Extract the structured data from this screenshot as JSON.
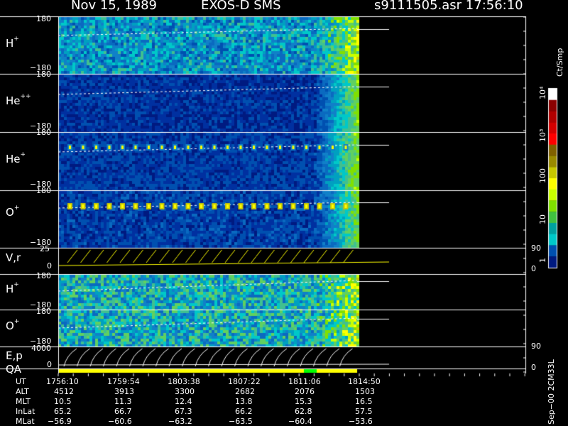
{
  "header": {
    "date": "Nov 15, 1989",
    "instrument": "EXOS-D SMS",
    "file_time": "s9111505.asr  17:56:10"
  },
  "panels": [
    {
      "label": "H",
      "charge": "+",
      "top": "180",
      "bottom": "−180"
    },
    {
      "label": "He",
      "charge": "++",
      "top": "180",
      "bottom": "−180"
    },
    {
      "label": "He",
      "charge": "+",
      "top": "180",
      "bottom": "−180"
    },
    {
      "label": "O",
      "charge": "+",
      "top": "180",
      "bottom": "−180"
    },
    {
      "label": "V,r",
      "charge": "",
      "top": "25",
      "bottom": "0",
      "right_top": "90",
      "right_bottom": "0"
    },
    {
      "label": "H",
      "charge": "+",
      "top": "180",
      "bottom": "−180"
    },
    {
      "label": "O",
      "charge": "+",
      "top": "180",
      "bottom": "−180"
    },
    {
      "label": "E,p",
      "charge": "",
      "top": "4000",
      "bottom": "0",
      "right_top": "90",
      "right_bottom": "0"
    }
  ],
  "qa_label": "QA",
  "colorbar": {
    "unit": "Ct/Smp",
    "ticks": [
      "10⁴",
      "10³",
      "100",
      "10",
      "1"
    ],
    "colors": [
      "#ffffff",
      "#8b0000",
      "#b00000",
      "#d40000",
      "#ff0000",
      "#806000",
      "#9a8a00",
      "#c8c800",
      "#ffff00",
      "#c8ff00",
      "#80e000",
      "#40c040",
      "#00a0a0",
      "#00c8c8",
      "#0050b0",
      "#001a80"
    ]
  },
  "ephemeris": {
    "rows": [
      {
        "name": "UT",
        "values": [
          "1756:10",
          "1759:54",
          "1803:38",
          "1807:22",
          "1811:06",
          "1814:50"
        ]
      },
      {
        "name": "ALT",
        "values": [
          "4512",
          "3913",
          "3300",
          "2682",
          "2076",
          "1503"
        ]
      },
      {
        "name": "MLT",
        "values": [
          "10.5",
          "11.3",
          "12.4",
          "13.8",
          "15.3",
          "16.5"
        ]
      },
      {
        "name": "InLat",
        "values": [
          "65.2",
          "66.7",
          "67.3",
          "66.2",
          "62.8",
          "57.5"
        ]
      },
      {
        "name": "MLat",
        "values": [
          "−56.9",
          "−60.6",
          "−63.2",
          "−63.5",
          "−60.4",
          "−53.6"
        ]
      }
    ]
  },
  "footer": "Sep−00  2CM33L"
}
